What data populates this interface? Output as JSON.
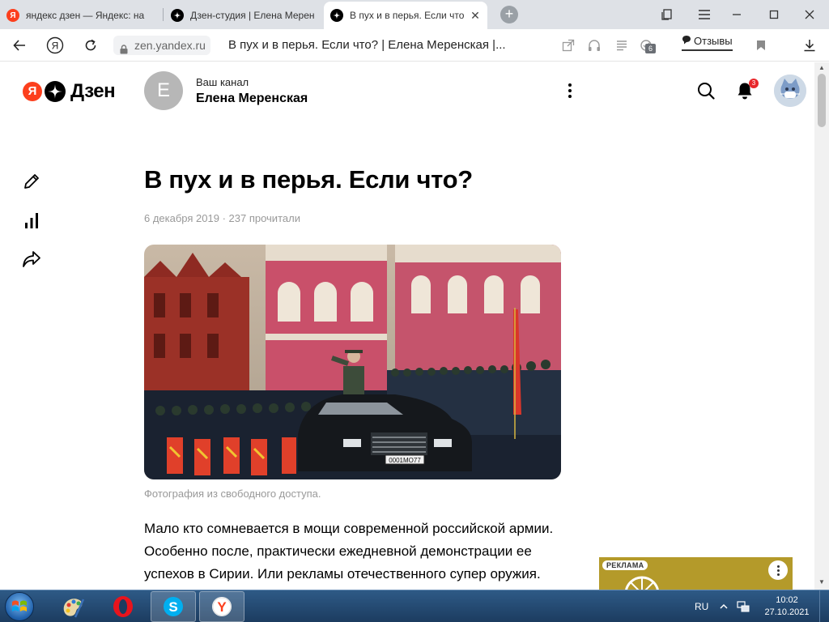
{
  "browser": {
    "tabs": [
      {
        "title": "яндекс дзен — Яндекс: на",
        "favicon": "yandex-icon",
        "active": false
      },
      {
        "title": "Дзен-студия | Елена Мерен",
        "favicon": "zen-icon",
        "active": false
      },
      {
        "title": "В пух и в перья. Если что",
        "favicon": "zen-icon",
        "active": true
      }
    ],
    "new_tab_icon": "plus-icon",
    "domain": "zen.yandex.ru",
    "page_title": "В пух и в перья. Если что? | Елена Меренская |...",
    "reviews_label": "Отзывы",
    "extensions_count": "6"
  },
  "zen": {
    "logo_text": "Дзен",
    "channel": {
      "avatar_letter": "Е",
      "caption": "Ваш канал",
      "name": "Елена Меренская"
    },
    "notifications_count": "3"
  },
  "article": {
    "title": "В пух и в перья. Если что?",
    "meta": "6 декабря 2019 · 237 прочитали",
    "photo_caption": "Фотография из свободного доступа.",
    "plate_text": "0001МО77",
    "body": "Мало кто сомневается в мощи современной российской армии. Особенно после, практически ежедневной демонстрации ее успехов в Сирии. Или рекламы отечественного супер оружия."
  },
  "ad": {
    "tag": "РЕКЛАМА"
  },
  "taskbar": {
    "language": "RU",
    "time": "10:02",
    "date": "27.10.2021",
    "apps": [
      "paint-icon",
      "opera-icon",
      "skype-icon",
      "yandex-browser-icon"
    ]
  },
  "colors": {
    "yandex_red": "#fc3f1d",
    "notification_red": "#e8272b",
    "ad_background": "#b49a2a",
    "taskbar_blue": "#2e5a86"
  }
}
